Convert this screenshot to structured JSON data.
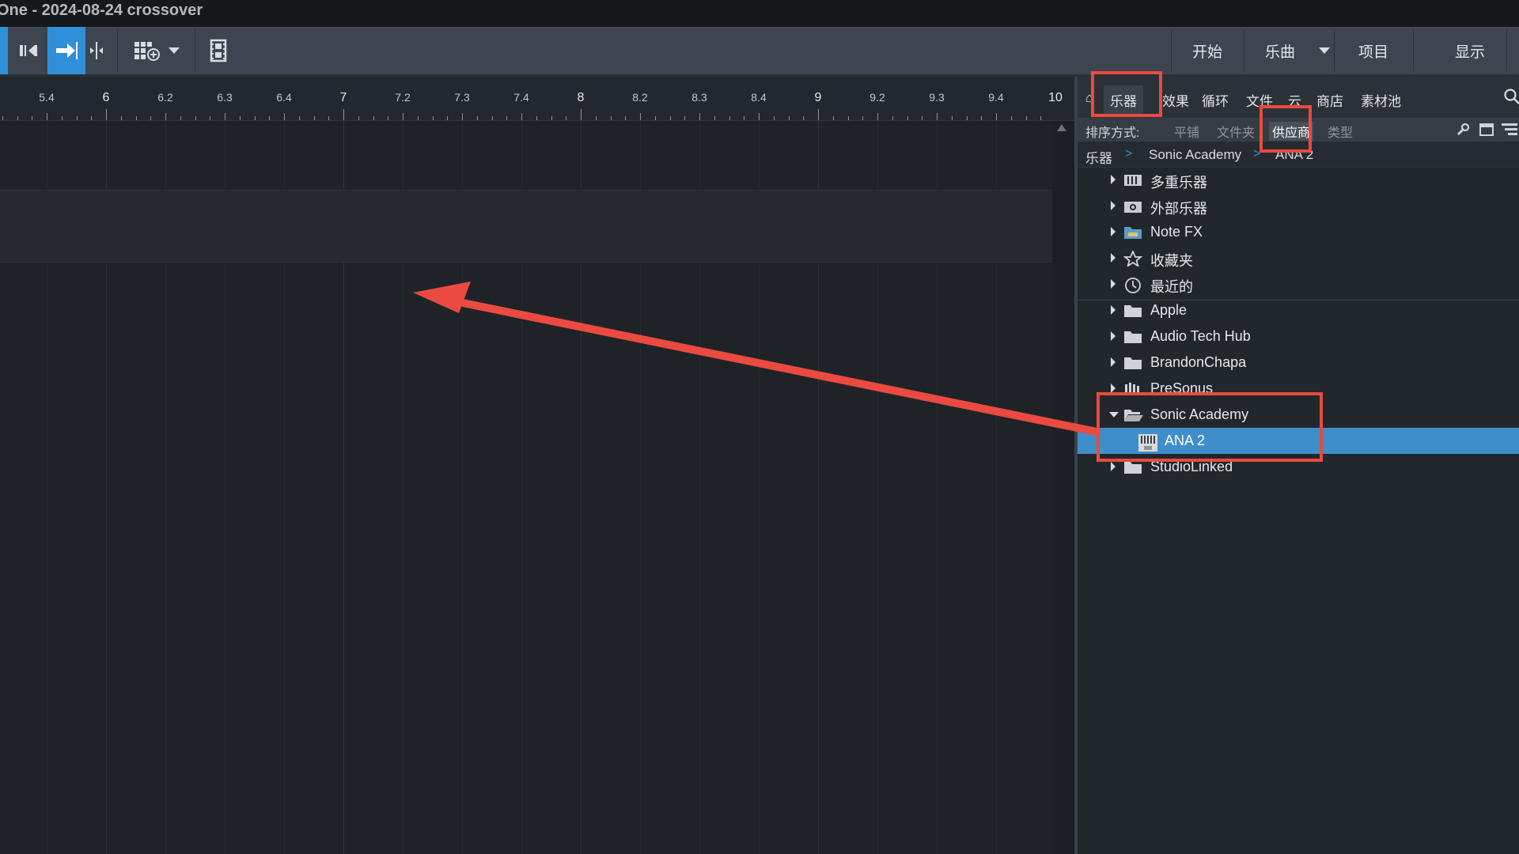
{
  "window": {
    "title": "One - 2024-08-24 crossover"
  },
  "toolbar": {
    "buttons": [
      {
        "name": "start",
        "label": "开始"
      },
      {
        "name": "song",
        "label": "乐曲"
      },
      {
        "name": "project",
        "label": "项目"
      },
      {
        "name": "show",
        "label": "显示"
      }
    ]
  },
  "ruler": {
    "labels": [
      "5.4",
      "6",
      "6.2",
      "6.3",
      "6.4",
      "7",
      "7.2",
      "7.3",
      "7.4",
      "8",
      "8.2",
      "8.3",
      "8.4",
      "9",
      "9.2",
      "9.3",
      "9.4",
      "10"
    ]
  },
  "browser": {
    "tabs": [
      "乐器",
      "效果",
      "循环",
      "文件",
      "云",
      "商店",
      "素材池"
    ],
    "selected_tab": "乐器",
    "sort": {
      "label": "排序方式:",
      "options": [
        "平铺",
        "文件夹",
        "供应商",
        "类型"
      ],
      "selected": "供应商"
    },
    "breadcrumb": [
      "乐器",
      "Sonic Academy",
      "ANA 2"
    ],
    "tree": [
      {
        "label": "多重乐器",
        "icon": "multi-instrument-icon",
        "expanded": false
      },
      {
        "label": "外部乐器",
        "icon": "external-instrument-icon",
        "expanded": false
      },
      {
        "label": "Note FX",
        "icon": "note-fx-folder-icon",
        "expanded": false
      },
      {
        "label": "收藏夹",
        "icon": "star-icon",
        "expanded": false
      },
      {
        "label": "最近的",
        "icon": "clock-icon",
        "expanded": false
      },
      {
        "label": "Apple",
        "icon": "folder-icon",
        "expanded": false
      },
      {
        "label": "Audio Tech Hub",
        "icon": "folder-icon",
        "expanded": false
      },
      {
        "label": "BrandonChapa",
        "icon": "folder-icon",
        "expanded": false
      },
      {
        "label": "PreSonus",
        "icon": "presonus-icon",
        "expanded": false
      },
      {
        "label": "Sonic Academy",
        "icon": "folder-open-icon",
        "expanded": true
      },
      {
        "label": "ANA 2",
        "icon": "au-plugin-icon",
        "selected": true,
        "child": true
      },
      {
        "label": "StudioLinked",
        "icon": "folder-icon",
        "expanded": false
      }
    ]
  },
  "colors": {
    "accent": "#2f8fd9",
    "selection": "#3e8fc9",
    "annotation": "#ea4a3f"
  }
}
